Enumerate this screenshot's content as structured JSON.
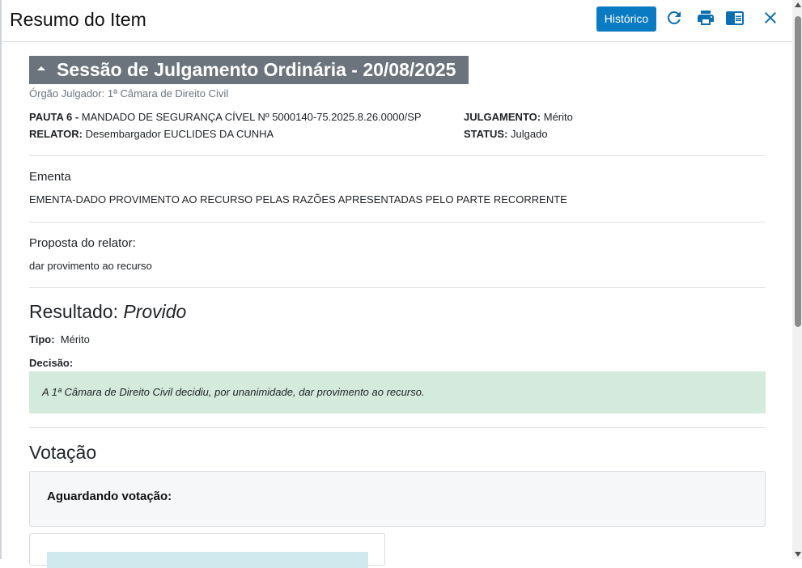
{
  "header": {
    "title": "Resumo do Item",
    "historico_label": "Histórico",
    "icons": [
      "refresh-icon",
      "print-icon",
      "reader-icon",
      "close-icon"
    ]
  },
  "session": {
    "title": "Sessão de Julgamento Ordinária - 20/08/2025",
    "orgao": "Órgão Julgador: 1ª Câmara de Direito Civil"
  },
  "pauta": {
    "label": "PAUTA 6 -",
    "value": "MANDADO DE SEGURANÇA CÍVEL Nº 5000140-75.2025.8.26.0000/SP",
    "relator_label": "RELATOR:",
    "relator_value": "Desembargador EUCLIDES DA CUNHA",
    "julgamento_label": "JULGAMENTO:",
    "julgamento_value": "Mérito",
    "status_label": "STATUS:",
    "status_value": "Julgado"
  },
  "ementa": {
    "title": "Ementa",
    "text": "EMENTA-DADO PROVIMENTO AO RECURSO PELAS RAZÕES APRESENTADAS PELO PARTE RECORRENTE"
  },
  "proposta": {
    "title": "Proposta do relator:",
    "text": "dar provimento ao recurso"
  },
  "resultado": {
    "label": "Resultado:",
    "value": "Provido",
    "tipo_label": "Tipo:",
    "tipo_value": "Mérito",
    "decisao_label": "Decisão:",
    "decisao_text": "A 1ª Câmara de Direito Civil decidiu, por unanimidade, dar provimento ao recurso."
  },
  "votacao": {
    "title": "Votação",
    "aguardando": "Aguardando votação:"
  },
  "colors": {
    "primary": "#0a7bc2",
    "session_bg": "#6b747d",
    "decisao_bg": "#d4eadc"
  }
}
